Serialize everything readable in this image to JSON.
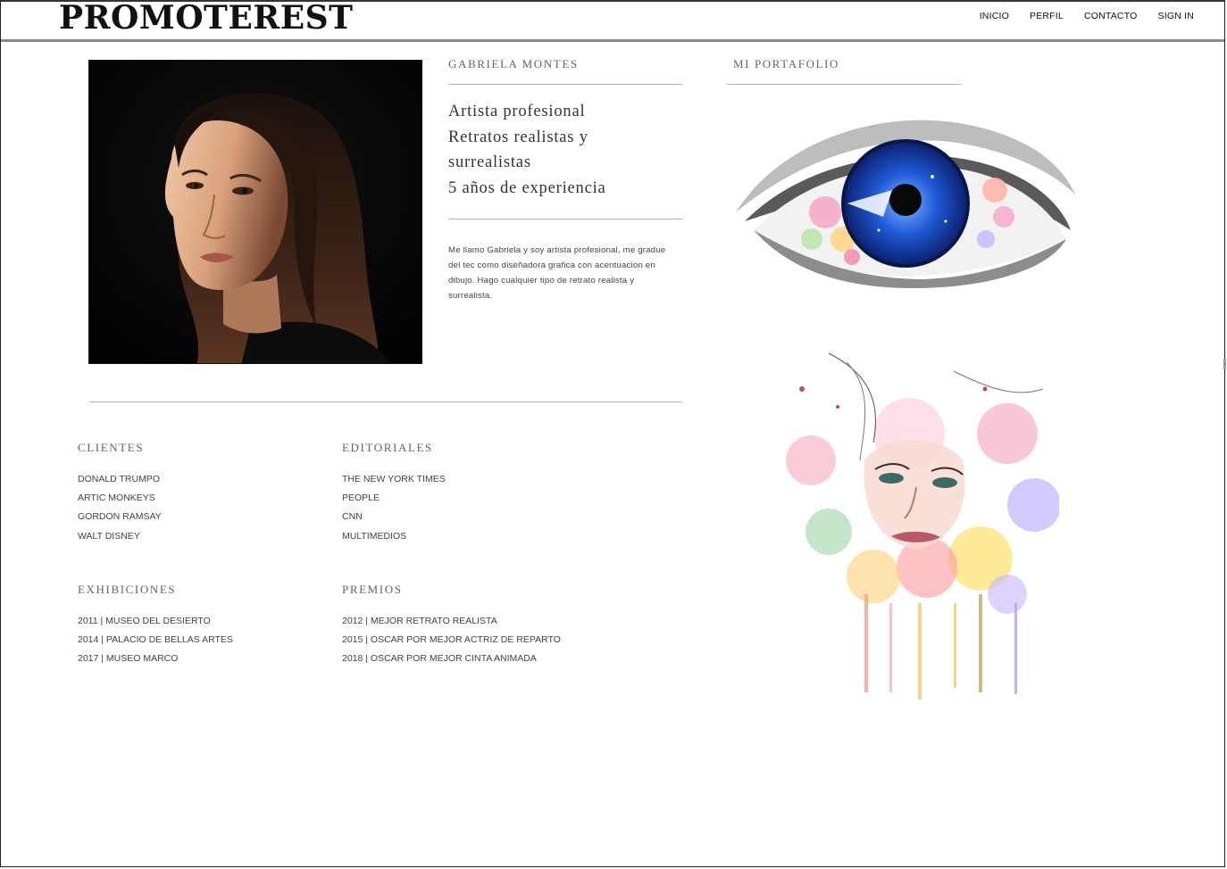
{
  "header": {
    "logo": "PROMOTEREST",
    "nav": [
      "INICIO",
      "PERFIL",
      "CONTACTO",
      "SIGN IN"
    ]
  },
  "profile": {
    "name": "GABRIELA MONTES",
    "tagline": [
      "Artista profesional",
      "Retratos realistas y",
      "surrealistas",
      "5 años de experiencia"
    ],
    "bio": "Me llamo Gabriela y soy artista profesional, me gradue del tec como diseñadora grafica con acentuacion en dibujo. Hago cualquier tipo de retrato realista y surrealista."
  },
  "portfolio": {
    "title": "MI PORTAFOLIO"
  },
  "clientes": {
    "title": "CLIENTES",
    "items": [
      "DONALD TRUMPO",
      "ARTIC MONKEYS",
      "GORDON RAMSAY",
      "WALT DISNEY"
    ]
  },
  "editoriales": {
    "title": "EDITORIALES",
    "items": [
      "THE NEW YORK TIMES",
      "PEOPLE",
      "CNN",
      "MULTIMEDIOS"
    ]
  },
  "exhibiciones": {
    "title": "EXHIBICIONES",
    "items": [
      "2011 | MUSEO DEL DESIERTO",
      "2014 | PALACIO DE BELLAS ARTES",
      "2017 | MUSEO MARCO"
    ]
  },
  "premios": {
    "title": "PREMIOS",
    "items": [
      "2012 | MEJOR RETRATO REALISTA",
      "2015 | OSCAR POR MEJOR ACTRIZ DE REPARTO",
      "2018 | OSCAR POR MEJOR CINTA ANIMADA"
    ]
  }
}
